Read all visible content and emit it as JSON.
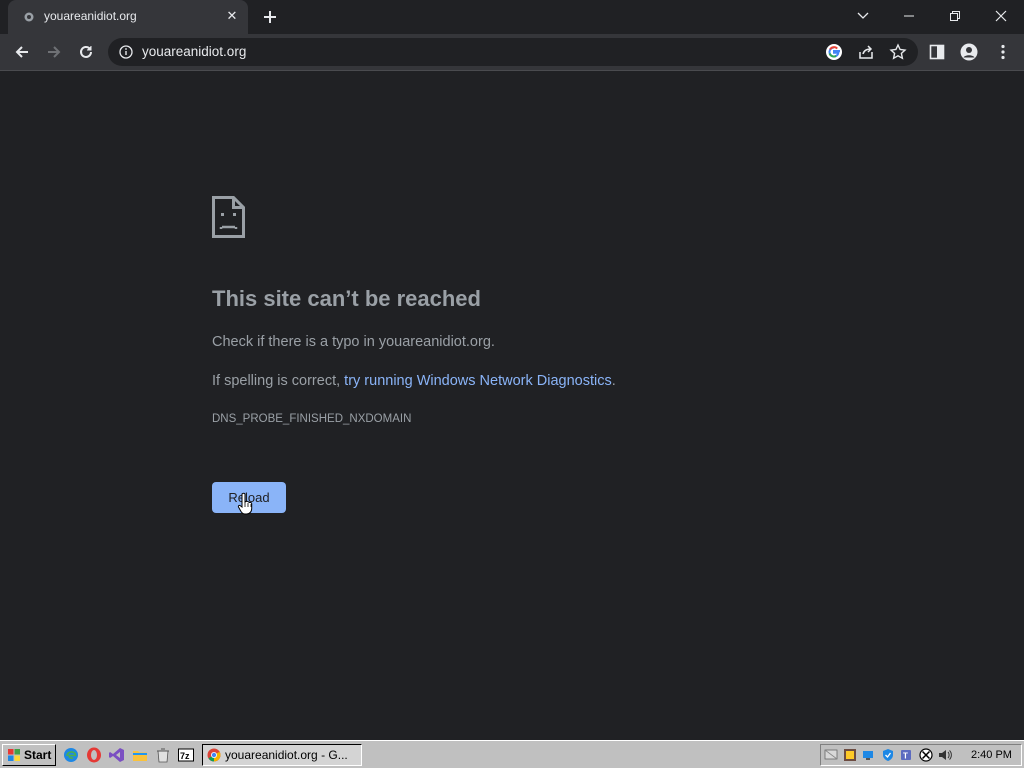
{
  "tab": {
    "title": "youareanidiot.org",
    "close": "✕"
  },
  "omnibox": {
    "url": "youareanidiot.org"
  },
  "error": {
    "heading": "This site can’t be reached",
    "line1": "Check if there is a typo in youareanidiot.org.",
    "line2_prefix": "If spelling is correct, ",
    "line2_link": "try running Windows Network Diagnostics",
    "line2_suffix": ".",
    "code": "DNS_PROBE_FINISHED_NXDOMAIN",
    "reload": "Reload"
  },
  "taskbar": {
    "start": "Start",
    "task_title": "youareanidiot.org - G...",
    "clock": "2:40 PM"
  },
  "colors": {
    "accent": "#8ab4f8",
    "background": "#202124",
    "toolbar": "#35363a",
    "text": "#9aa0a6"
  },
  "icons": [
    "info-icon",
    "google-icon",
    "share-icon",
    "star-icon",
    "side-panel-icon",
    "profile-icon",
    "menu-icon",
    "sad-page-icon"
  ]
}
